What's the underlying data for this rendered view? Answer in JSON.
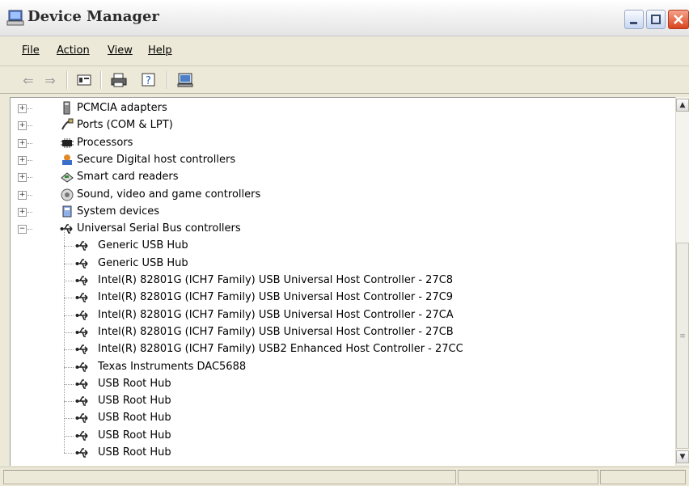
{
  "window": {
    "title": "Device Manager",
    "accent": "#245edb",
    "close_color": "#d9431e"
  },
  "menubar": {
    "items": [
      "File",
      "Action",
      "View",
      "Help"
    ]
  },
  "toolbar": {
    "buttons": [
      "back-arrow-icon",
      "forward-arrow-icon",
      "properties-icon",
      "print-icon",
      "help-icon",
      "scan-hardware-icon"
    ]
  },
  "tree": {
    "categories": [
      {
        "label": "PCMCIA adapters",
        "icon": "pcmcia-card-icon",
        "expanded": false
      },
      {
        "label": "Ports (COM & LPT)",
        "icon": "port-plug-icon",
        "expanded": false
      },
      {
        "label": "Processors",
        "icon": "processor-chip-icon",
        "expanded": false
      },
      {
        "label": "Secure Digital host controllers",
        "icon": "sd-controller-icon",
        "expanded": false
      },
      {
        "label": "Smart card readers",
        "icon": "smart-card-reader-icon",
        "expanded": false
      },
      {
        "label": "Sound, video and game controllers",
        "icon": "speaker-icon",
        "expanded": false
      },
      {
        "label": "System devices",
        "icon": "system-devices-icon",
        "expanded": false
      },
      {
        "label": "Universal Serial Bus controllers",
        "icon": "usb-icon",
        "expanded": true
      }
    ],
    "usb_children": [
      "Generic USB Hub",
      "Generic USB Hub",
      "Intel(R) 82801G (ICH7 Family) USB Universal Host Controller - 27C8",
      "Intel(R) 82801G (ICH7 Family) USB Universal Host Controller - 27C9",
      "Intel(R) 82801G (ICH7 Family) USB Universal Host Controller - 27CA",
      "Intel(R) 82801G (ICH7 Family) USB Universal Host Controller - 27CB",
      "Intel(R) 82801G (ICH7 Family) USB2 Enhanced Host Controller - 27CC",
      "Texas Instruments DAC5688",
      "USB Root Hub",
      "USB Root Hub",
      "USB Root Hub",
      "USB Root Hub",
      "USB Root Hub"
    ]
  },
  "scrollbar": {
    "up": "▲",
    "down": "▼",
    "grip": "≡"
  }
}
